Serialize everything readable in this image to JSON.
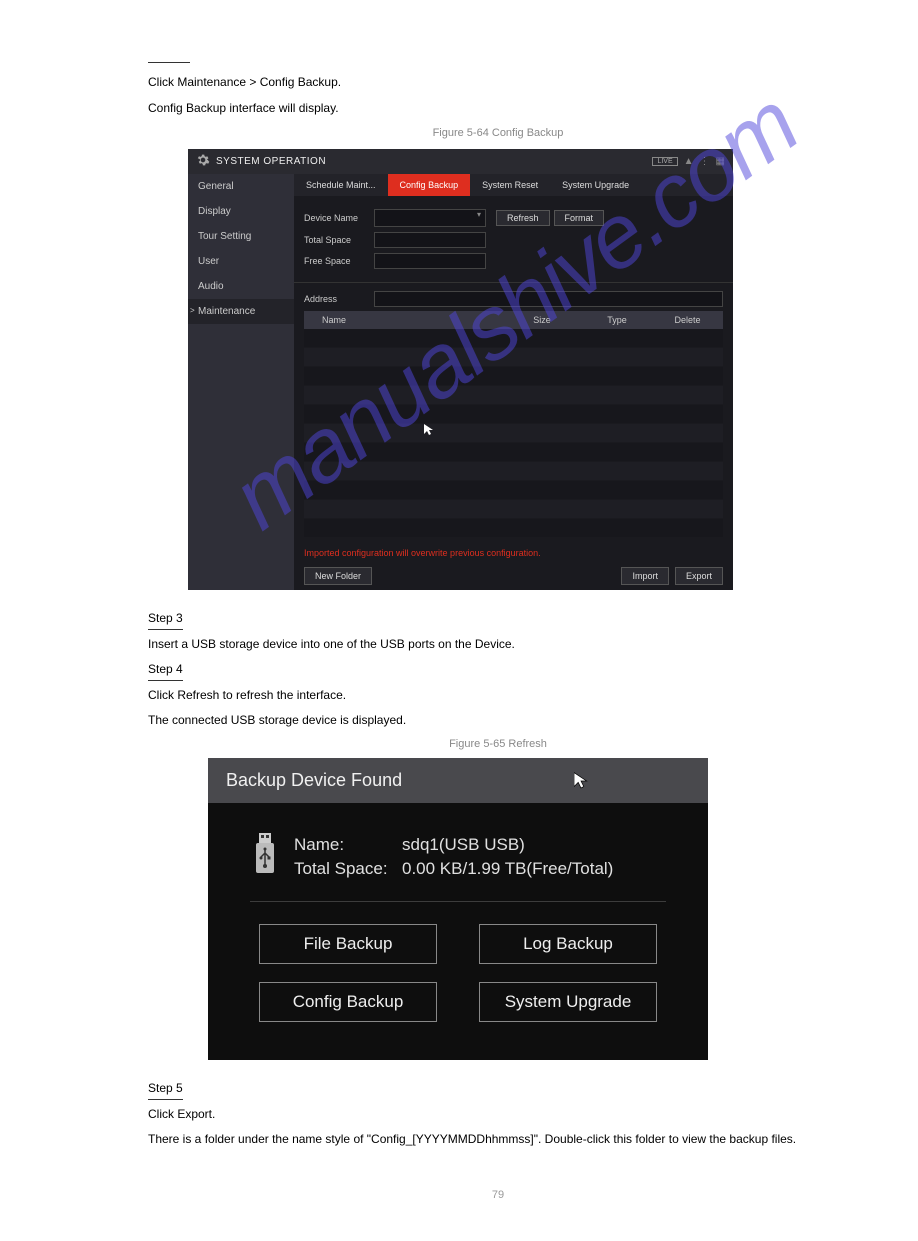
{
  "watermark": "manualshive.com",
  "step2_body_1": "Click Maintenance > Config Backup.",
  "step2_body_2": "Config Backup interface will display.",
  "fig_64_label": "Figure 5-64 Config Backup",
  "screenshot1": {
    "title": "SYSTEM OPERATION",
    "live": "LIVE",
    "sidebar": [
      "General",
      "Display",
      "Tour Setting",
      "User",
      "Audio",
      "Maintenance"
    ],
    "tabs": [
      "Schedule Maint...",
      "Config Backup",
      "System Reset",
      "System Upgrade"
    ],
    "labels": {
      "device_name": "Device Name",
      "total_space": "Total Space",
      "free_space": "Free Space",
      "address": "Address"
    },
    "buttons": {
      "refresh": "Refresh",
      "format": "Format",
      "new_folder": "New Folder",
      "import": "Import",
      "export": "Export"
    },
    "columns": {
      "name": "Name",
      "size": "Size",
      "type": "Type",
      "delete": "Delete"
    },
    "warning": "Imported configuration will overwrite previous configuration."
  },
  "step3_body": "Insert a USB storage device into one of the USB ports on the Device.",
  "step4_body_1": "Click Refresh to refresh the interface.",
  "step4_body_2": "The connected USB storage device is displayed.",
  "fig_65_label": "Figure 5-65 Refresh",
  "screenshot2": {
    "title": "Backup Device Found",
    "name_label": "Name:",
    "name_value": "sdq1(USB USB)",
    "space_label": "Total Space:",
    "space_value": "0.00 KB/1.99 TB(Free/Total)",
    "buttons": {
      "file_backup": "File Backup",
      "log_backup": "Log Backup",
      "config_backup": "Config Backup",
      "system_upgrade": "System Upgrade"
    }
  },
  "step5_body_1": "Click Export.",
  "step5_body_2": "There is a folder under the name style of \"Config_[YYYYMMDDhhmmss]\". Double-click this folder to view the backup files.",
  "page_number": "79"
}
